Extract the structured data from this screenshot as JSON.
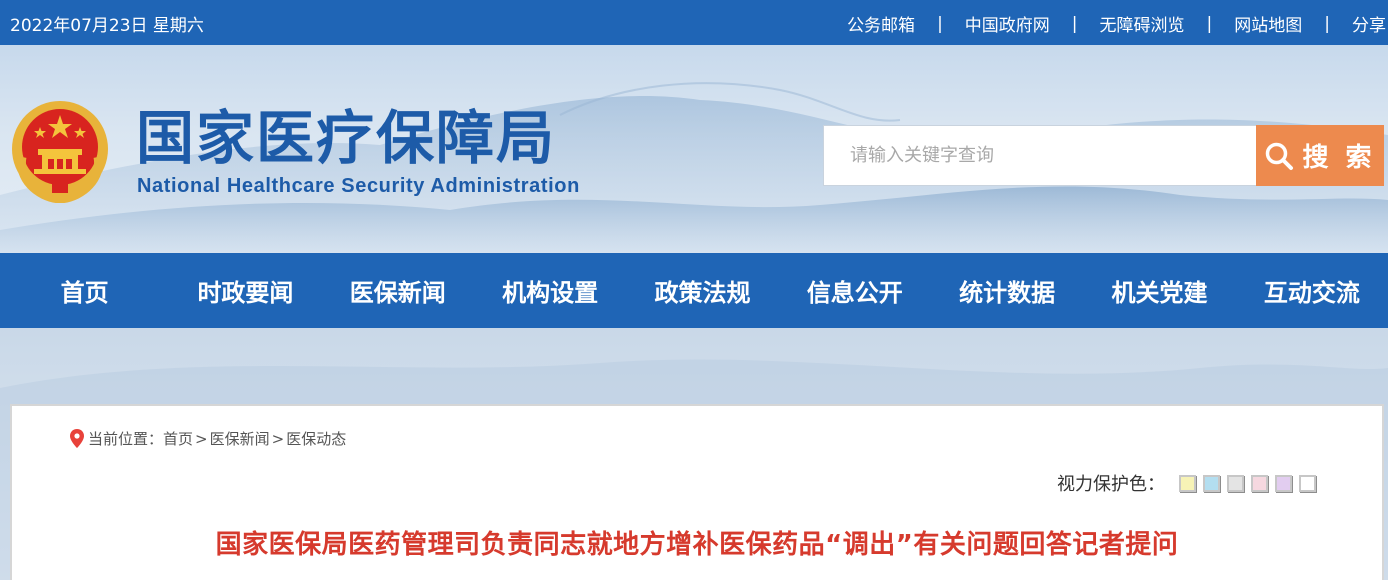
{
  "topbar": {
    "date": "2022年07月23日 星期六",
    "links": [
      "公务邮箱",
      "中国政府网",
      "无障碍浏览",
      "网站地图",
      "分享"
    ],
    "separator": "|"
  },
  "header": {
    "title_cn": "国家医疗保障局",
    "title_en": "National Healthcare Security Administration",
    "emblem_icon": "national-emblem-icon"
  },
  "search": {
    "placeholder": "请输入关键字查询",
    "value": "",
    "button_label": "搜 索",
    "icon": "search-icon"
  },
  "nav": {
    "items": [
      "首页",
      "时政要闻",
      "医保新闻",
      "机构设置",
      "政策法规",
      "信息公开",
      "统计数据",
      "机关党建",
      "互动交流"
    ]
  },
  "breadcrumb": {
    "label": "当前位置：",
    "items": [
      "首页",
      "医保新闻",
      "医保动态"
    ],
    "separator": ">",
    "icon": "location-pin-icon"
  },
  "eye_protection": {
    "label": "视力保护色：",
    "colors": [
      "#f7f3b6",
      "#b3def0",
      "#e4e4e4",
      "#f6d8e0",
      "#e2cdf0",
      "#ffffff"
    ]
  },
  "article": {
    "title": "国家医保局医药管理司负责同志就地方增补医保药品“调出”有关问题回答记者提问"
  },
  "colors": {
    "primary_blue": "#1f65b6",
    "search_orange": "#ed8a4e",
    "title_red": "#d63a2d"
  }
}
